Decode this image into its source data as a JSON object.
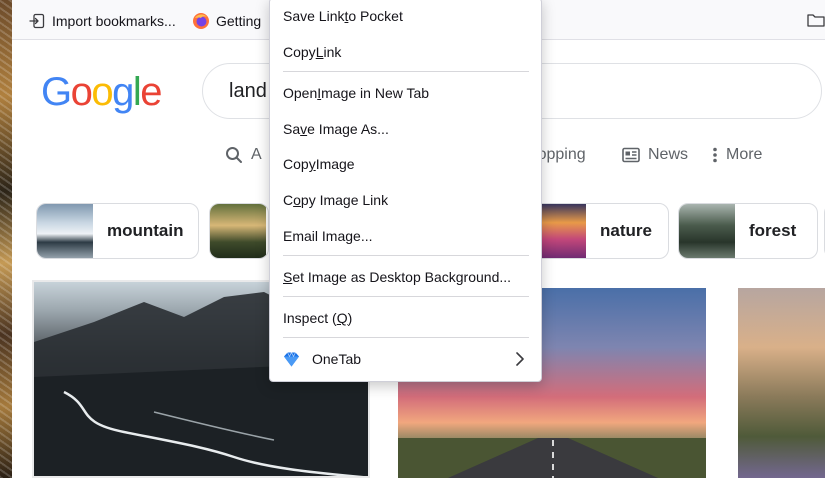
{
  "bookmarks": {
    "import_label": "Import bookmarks...",
    "getting_label": "Getting"
  },
  "google": {
    "logo_letters": [
      {
        "ch": "G",
        "color": "#4285F4"
      },
      {
        "ch": "o",
        "color": "#EA4335"
      },
      {
        "ch": "o",
        "color": "#FBBC05"
      },
      {
        "ch": "g",
        "color": "#4285F4"
      },
      {
        "ch": "l",
        "color": "#34A853"
      },
      {
        "ch": "e",
        "color": "#EA4335"
      }
    ],
    "search_value": "land"
  },
  "tabs": {
    "all": "A",
    "shopping": "Shopping",
    "news": "News",
    "more": "More"
  },
  "chips": {
    "mountain": "mountain",
    "nature": "nature",
    "forest": "forest"
  },
  "context_menu": {
    "items": [
      {
        "pre": "Save Link ",
        "u": "t",
        "post": "o Pocket"
      },
      {
        "pre": "Copy ",
        "u": "L",
        "post": "ink"
      },
      {
        "pre": "Open ",
        "u": "I",
        "post": "mage in New Tab"
      },
      {
        "pre": "Sa",
        "u": "v",
        "post": "e Image As..."
      },
      {
        "pre": "Cop",
        "u": "y",
        "post": " Image"
      },
      {
        "pre": "C",
        "u": "o",
        "post": "py Image Link"
      },
      {
        "pre": "Email Ima",
        "u": "g",
        "post": "e..."
      },
      {
        "pre": "",
        "u": "S",
        "post": "et Image as Desktop Background..."
      },
      {
        "pre": "Inspect (",
        "u": "Q",
        "post": ")"
      },
      {
        "pre": "OneTab",
        "u": "",
        "post": ""
      }
    ]
  },
  "colors": {
    "accent_blue": "#4285F4",
    "onetab_icon": "#1a73e8"
  }
}
